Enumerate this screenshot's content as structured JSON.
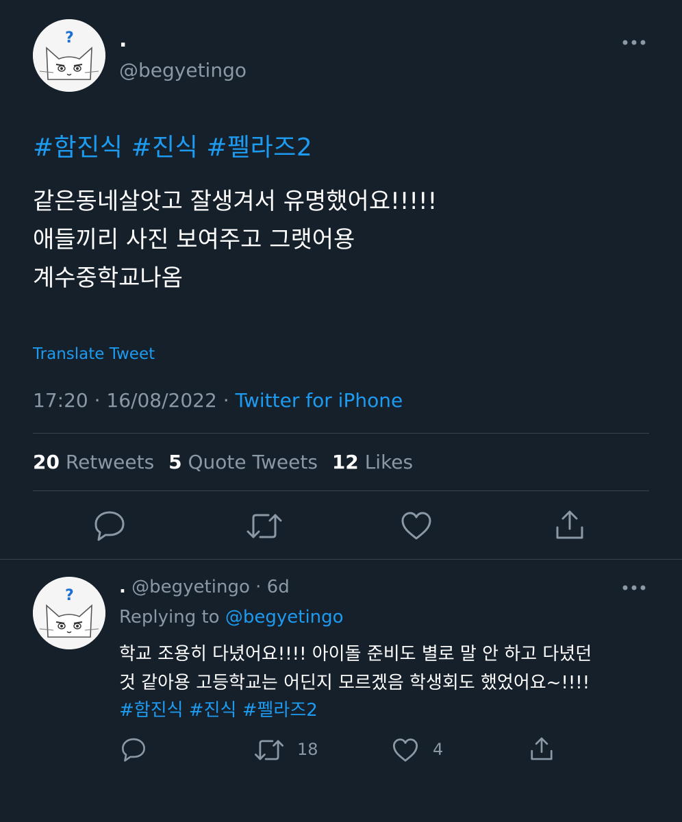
{
  "tweet": {
    "display_name": ".",
    "handle": "@begyetingo",
    "hashtags": "#함진식 #진식 #펠라즈2",
    "text": "같은동네살앗고 잘생겨서 유명했어요!!!!!\n애들끼리 사진 보여주고 그랫어용\n계수중학교나옴",
    "translate_label": "Translate Tweet",
    "time": "17:20",
    "date": "16/08/2022",
    "dot_separator": "·",
    "source": "Twitter for iPhone",
    "stats": {
      "retweets_count": "20",
      "retweets_label": "Retweets",
      "quotes_count": "5",
      "quotes_label": "Quote Tweets",
      "likes_count": "12",
      "likes_label": "Likes"
    },
    "icons": [
      "reply-icon",
      "retweet-icon",
      "like-icon",
      "share-icon",
      "more-icon"
    ]
  },
  "reply": {
    "display_name": ".",
    "handle": "@begyetingo",
    "separator": "·",
    "age": "6d",
    "replying_prefix": "Replying to",
    "replying_to": "@begyetingo",
    "line1": "학교 조용히 다녔어요!!!! 아이돌 준비도 별로 말 안 하고 다녔던",
    "line2": "것 같아용 고등학교는 어딘지 모르겠음 학생회도 했었어요~!!!!",
    "hashtags": "#함진식 #진식 #펠라즈2",
    "retweet_count": "18",
    "like_count": "4"
  },
  "colors": {
    "background": "#15202b",
    "accent": "#1d9bf0",
    "secondary_text": "#8b98a5",
    "divider": "#38444d"
  }
}
